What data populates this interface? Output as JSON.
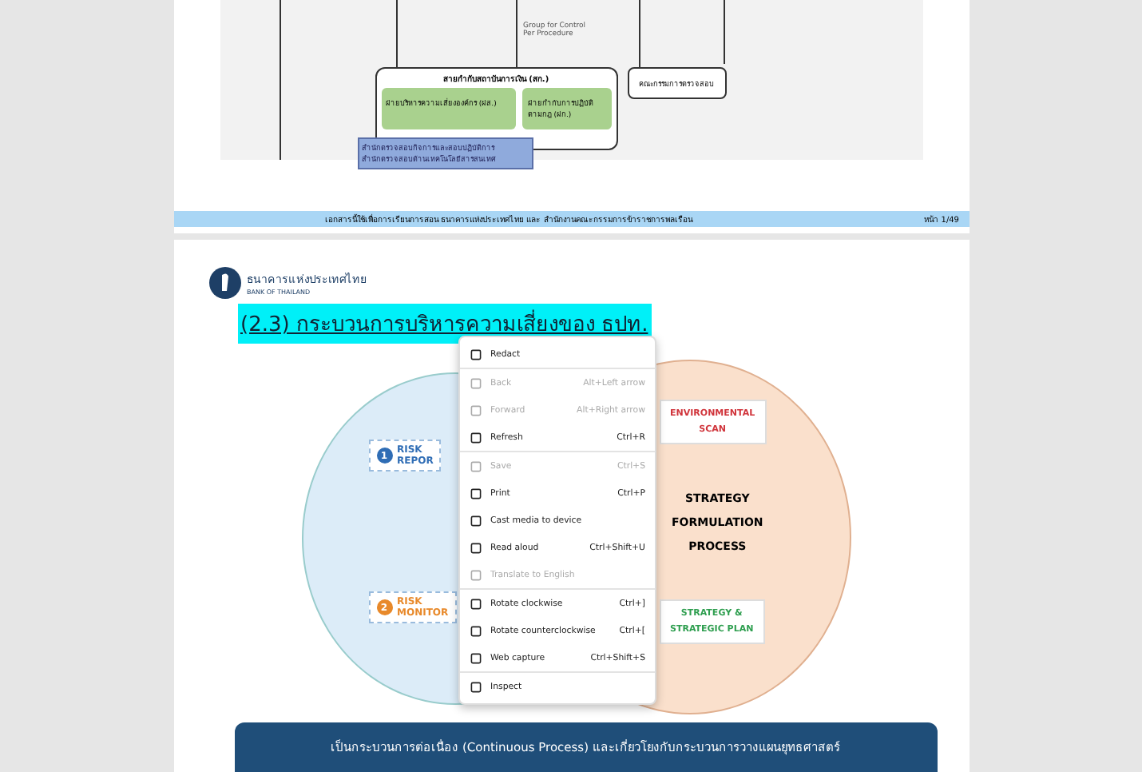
{
  "top_page": {
    "diagram": {
      "note": "Group for Control Per Procedure",
      "group_title": "สายกำกับสถาบันการเงิน (สก.)",
      "box_left": "ฝ่ายบริหารความเสี่ยงองค์กร (ฝส.)",
      "box_right": "ฝ่ายกำกับการปฏิบัติตามกฎ (ฝก.)",
      "box_outside": "คณะกรรมการตรวจสอบ",
      "box_bottom": [
        "สำนักตรวจสอบกิจการและสอบปฏิบัติการ",
        "สำนักตรวจสอบด้านเทคโนโลยีสารสนเทศ"
      ]
    },
    "footer": {
      "text": "เอกสารนี้ใช้เพื่อการเรียนการสอน ธนาคารแห่งประเทศไทย และ สำนักงานคณะกรรมการข้าราชการพลเรือน",
      "page": "หน้า 1/49"
    }
  },
  "slide": {
    "org_name": "ธนาคารแห่งประเทศไทย",
    "org_name_en": "BANK OF THAILAND",
    "title": "(2.3) กระบวนการบริหารความเสี่ยงของ ธปท.",
    "left_labels": [
      {
        "number": "1",
        "text": [
          "RISK",
          "REPOR"
        ],
        "color": "#2f6db5"
      },
      {
        "number": "2",
        "text": [
          "RISK",
          "MONITOR"
        ],
        "color": "#e8892a"
      }
    ],
    "right_labels": [
      {
        "text": [
          "ENVIRONMENTAL",
          "SCAN"
        ],
        "color": "#d0333a"
      },
      {
        "text": [
          "STRATEGY &",
          "STRATEGIC PLAN"
        ],
        "color": "#2e9e4f"
      }
    ],
    "center": [
      "STRATEGY",
      "FORMULATION",
      "PROCESS"
    ],
    "banner": "เป็นกระบวนการต่อเนื่อง (Continuous Process) และเกี่ยวโยงกับกระบวนการวางแผนยุทธศาสตร์"
  },
  "context_menu": [
    {
      "label": "Redact",
      "disabled": false,
      "separator_before": false
    },
    {
      "label": "Back",
      "shortcut": "Alt+Left arrow",
      "disabled": true,
      "separator_before": true
    },
    {
      "label": "Forward",
      "shortcut": "Alt+Right arrow",
      "disabled": true,
      "separator_before": false
    },
    {
      "label": "Refresh",
      "shortcut": "Ctrl+R",
      "disabled": false,
      "separator_before": false
    },
    {
      "label": "Save",
      "shortcut": "Ctrl+S",
      "disabled": true,
      "separator_before": true
    },
    {
      "label": "Print",
      "shortcut": "Ctrl+P",
      "disabled": false,
      "separator_before": false
    },
    {
      "label": "Cast media to device",
      "disabled": false,
      "separator_before": false
    },
    {
      "label": "Read aloud",
      "shortcut": "Ctrl+Shift+U",
      "disabled": false,
      "separator_before": false
    },
    {
      "label": "Translate to English",
      "disabled": true,
      "separator_before": false
    },
    {
      "label": "Rotate clockwise",
      "shortcut": "Ctrl+]",
      "disabled": false,
      "separator_before": true
    },
    {
      "label": "Rotate counterclockwise",
      "shortcut": "Ctrl+[",
      "disabled": false,
      "separator_before": false
    },
    {
      "label": "Web capture",
      "shortcut": "Ctrl+Shift+S",
      "disabled": false,
      "separator_before": false
    },
    {
      "label": "Inspect",
      "disabled": false,
      "separator_before": true
    }
  ]
}
